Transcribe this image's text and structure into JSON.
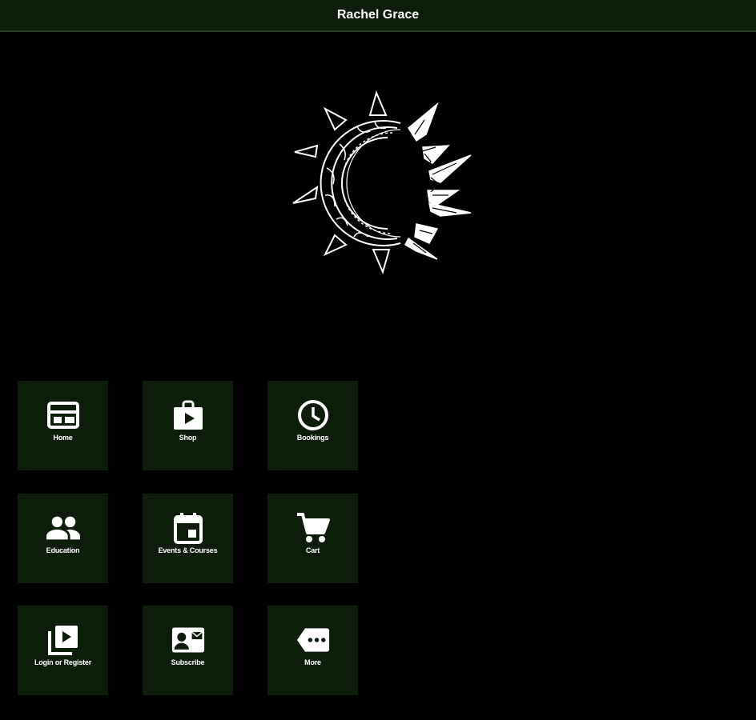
{
  "header": {
    "title": "Rachel Grace"
  },
  "colors": {
    "background": "#000000",
    "tile": "#0c1d0a",
    "header": "#0c1d0a",
    "text": "#ffffff"
  },
  "tiles": [
    {
      "label": "Home",
      "icon": "web-layout-icon"
    },
    {
      "label": "Shop",
      "icon": "shop-bag-icon"
    },
    {
      "label": "Bookings",
      "icon": "clock-icon"
    },
    {
      "label": "Education",
      "icon": "people-icon"
    },
    {
      "label": "Events & Courses",
      "icon": "calendar-icon"
    },
    {
      "label": "Cart",
      "icon": "cart-icon"
    },
    {
      "label": "Login or Register",
      "icon": "video-library-icon"
    },
    {
      "label": "Subscribe",
      "icon": "contact-mail-icon"
    },
    {
      "label": "More",
      "icon": "more-tag-icon"
    }
  ]
}
